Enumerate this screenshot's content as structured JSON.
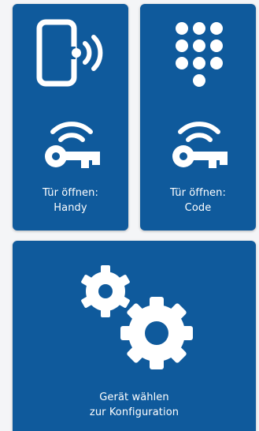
{
  "colors": {
    "card": "#0f5a9c",
    "page": "#f4f5f7",
    "icon": "#ffffff"
  },
  "cards": {
    "phone": {
      "line1": "Tür öffnen:",
      "line2": "Handy",
      "icon": "phone-nfc-icon",
      "icon2": "wireless-key-icon"
    },
    "code": {
      "line1": "Tür öffnen:",
      "line2": "Code",
      "icon": "keypad-icon",
      "icon2": "wireless-key-icon"
    },
    "config": {
      "line1": "Gerät wählen",
      "line2": "zur Konfiguration",
      "icon": "gears-icon"
    }
  }
}
